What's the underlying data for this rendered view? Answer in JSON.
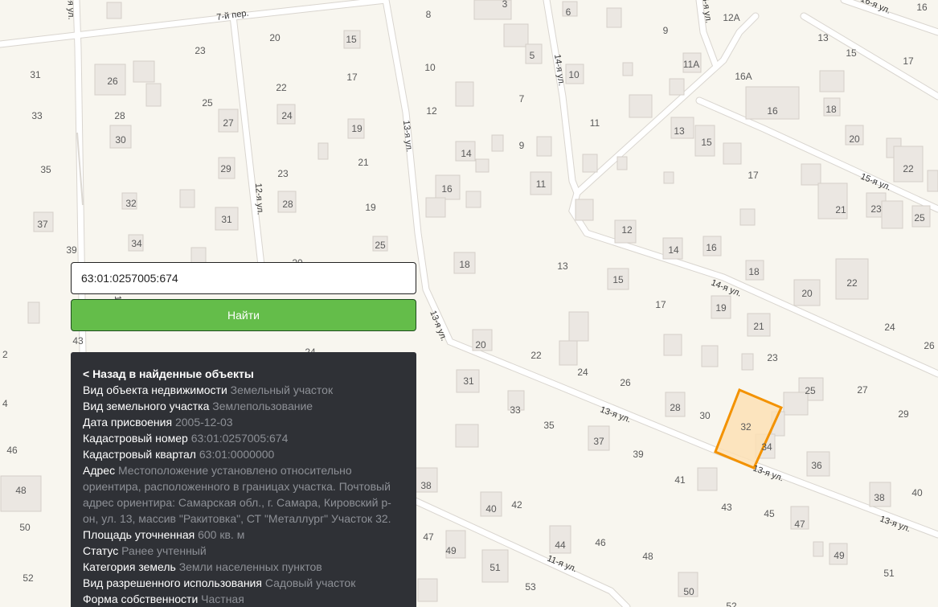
{
  "search": {
    "value": "63:01:0257005:674",
    "button_label": "Найти"
  },
  "info": {
    "back_label": "< Назад в найденные объекты",
    "rows": [
      {
        "label": "Вид объекта недвижимости",
        "value": "Земельный участок"
      },
      {
        "label": "Вид земельного участка",
        "value": "Землепользование"
      },
      {
        "label": "Дата присвоения",
        "value": "2005-12-03"
      },
      {
        "label": "Кадастровый номер",
        "value": "63:01:0257005:674"
      },
      {
        "label": "Кадастровый квартал",
        "value": "63:01:0000000"
      },
      {
        "label": "Адрес",
        "value": "Местоположение установлено относительно ориентира, расположенного в границах участка. Почтовый адрес ориентира: Самарская обл., г. Самара, Кировский р-он, ул. 13, массив \"Ракитовка\", СТ \"Металлург\" Участок 32."
      },
      {
        "label": "Площадь уточненная",
        "value": "600 кв. м"
      },
      {
        "label": "Статус",
        "value": "Ранее учтенный"
      },
      {
        "label": "Категория земель",
        "value": "Земли населенных пунктов"
      },
      {
        "label": "Вид разрешенного использования",
        "value": "Садовый участок"
      },
      {
        "label": "Форма собственности",
        "value": "Частная"
      }
    ]
  },
  "map": {
    "colors": {
      "background": "#f8f6ef",
      "road": "#ffffff",
      "building": "#ebe7e2",
      "highlight_fill": "#fde0b5",
      "highlight_stroke": "#f39200"
    },
    "streets": [
      {
        "key": "s7per",
        "label": "7-й пер."
      },
      {
        "key": "s12a",
        "label": "12-я ул."
      },
      {
        "key": "s12b",
        "label": "12-я ул."
      },
      {
        "key": "s13a",
        "label": "13-я ул."
      },
      {
        "key": "s13b",
        "label": "13-я ул."
      },
      {
        "key": "s13c",
        "label": "13-я ул."
      },
      {
        "key": "s13d",
        "label": "13-я ул."
      },
      {
        "key": "s13e",
        "label": "13-я ул."
      },
      {
        "key": "s14a",
        "label": "14-я ул."
      },
      {
        "key": "s14b",
        "label": "14-я ул."
      },
      {
        "key": "s15",
        "label": "15-я ул."
      },
      {
        "key": "s16a",
        "label": "16-я ул."
      },
      {
        "key": "s16b",
        "label": "16-я ул."
      },
      {
        "key": "s11",
        "label": "11-я ул."
      },
      {
        "key": "s1",
        "label": "1"
      }
    ],
    "house_numbers": [
      "3",
      "8",
      "6",
      "9",
      "12А",
      "16",
      "20",
      "23",
      "15",
      "31",
      "26",
      "10",
      "5",
      "10",
      "13",
      "15",
      "17",
      "11А",
      "16А",
      "22",
      "17",
      "33",
      "28",
      "25",
      "24",
      "12",
      "7",
      "16",
      "18",
      "27",
      "19",
      "30",
      "14",
      "9",
      "11",
      "13",
      "15",
      "20",
      "35",
      "29",
      "21",
      "16",
      "17",
      "22",
      "32",
      "28",
      "23",
      "11",
      "21",
      "23",
      "25",
      "37",
      "31",
      "19",
      "12",
      "34",
      "25",
      "18",
      "14",
      "16",
      "39",
      "20",
      "13",
      "15",
      "18",
      "22",
      "17",
      "19",
      "20",
      "24",
      "21",
      "26",
      "43",
      "20",
      "22",
      "23",
      "31",
      "24",
      "26",
      "25",
      "27",
      "33",
      "28",
      "30",
      "29",
      "35",
      "37",
      "39",
      "32",
      "34",
      "36",
      "46",
      "38",
      "41",
      "40",
      "40",
      "42",
      "43",
      "45",
      "38",
      "48",
      "50",
      "47",
      "49",
      "44",
      "46",
      "48",
      "47",
      "49",
      "51",
      "52",
      "51",
      "53",
      "50",
      "52",
      "2",
      "4",
      "24"
    ],
    "highlighted_parcel": "32"
  }
}
